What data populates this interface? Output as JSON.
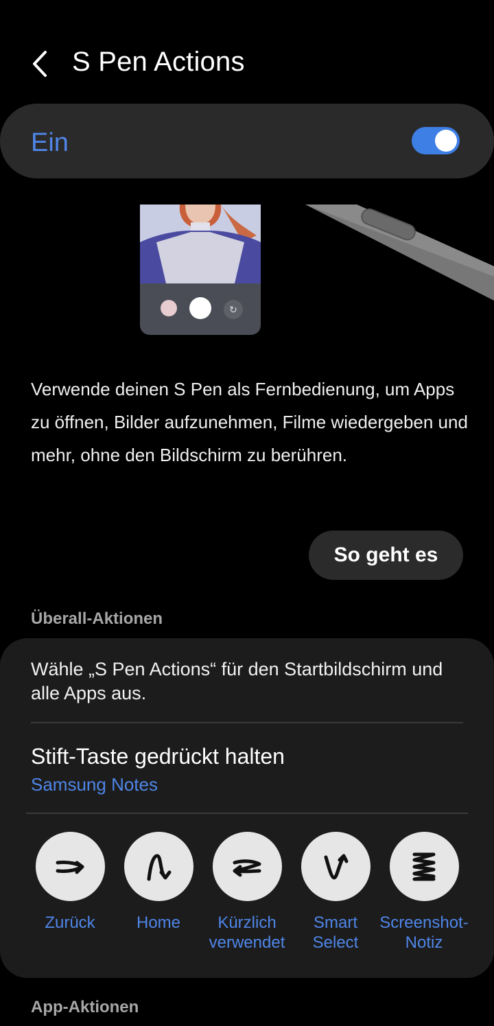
{
  "header": {
    "title": "S Pen Actions"
  },
  "master_switch": {
    "label": "Ein",
    "state": "on",
    "accent_color": "#3e7fe6"
  },
  "description": "Verwende deinen S Pen als Fernbedienung, um Apps zu öffnen, Bilder aufzunehmen, Filme wiedergeben und mehr, ohne den Bildschirm zu berühren.",
  "how_to_button": "So geht es",
  "section_anywhere": "Überall-Aktionen",
  "anywhere_card": {
    "description": "Wähle „S Pen Actions“ für den Startbildschirm und alle Apps aus.",
    "press_hold": {
      "title": "Stift-Taste gedrückt halten",
      "value": "Samsung Notes"
    },
    "gestures": [
      {
        "label": "Zurück",
        "icon": "back-gesture-icon"
      },
      {
        "label": "Home",
        "icon": "home-gesture-icon"
      },
      {
        "label": "Kürzlich verwendet",
        "icon": "recents-gesture-icon"
      },
      {
        "label": "Smart Select",
        "icon": "smart-select-gesture-icon"
      },
      {
        "label": "Screenshot-Notiz",
        "icon": "screenshot-gesture-icon"
      }
    ]
  },
  "section_app": "App-Aktionen"
}
